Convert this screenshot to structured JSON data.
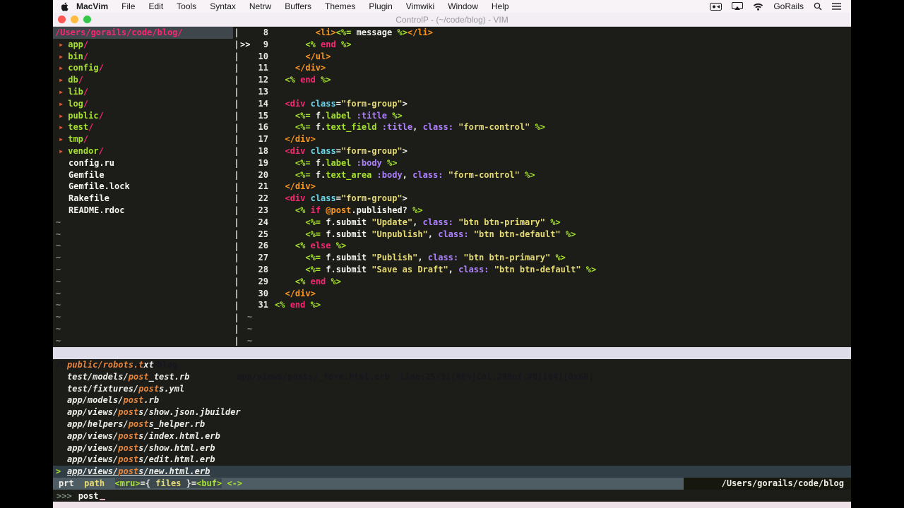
{
  "colors": {
    "w": "#f8f8f2",
    "p": "#f92672",
    "g": "#a6e22e",
    "y": "#e6db74",
    "o": "#fd971f",
    "u": "#ae81ff",
    "c": "#66d9ef"
  },
  "menubar": {
    "items": [
      "MacVim",
      "File",
      "Edit",
      "Tools",
      "Syntax",
      "Netrw",
      "Buffers",
      "Themes",
      "Plugin",
      "Vimwiki",
      "Window",
      "Help"
    ],
    "right_label": "GoRails"
  },
  "titlebar": {
    "title": "ControlP - (~/code/blog) - VIM"
  },
  "nerdtree": {
    "root": "/Users/gorails/code/blog/",
    "dirs": [
      "app",
      "bin",
      "config",
      "db",
      "lib",
      "log",
      "public",
      "test",
      "tmp",
      "vendor"
    ],
    "files": [
      "config.ru",
      "Gemfile",
      "Gemfile.lock",
      "Rakefile",
      "README.rdoc"
    ],
    "tilde": "~",
    "tilde_count": 11
  },
  "editor": {
    "tilde": "~",
    "tilde_count": 3,
    "lines": [
      {
        "n": "8",
        "s": "",
        "t": [
          [
            "        ",
            "w"
          ],
          [
            "<li>",
            "o"
          ],
          [
            "<%=",
            "g"
          ],
          [
            " message ",
            "w"
          ],
          [
            "%>",
            "g"
          ],
          [
            "</li>",
            "o"
          ]
        ]
      },
      {
        "n": "9",
        "s": ">>",
        "t": [
          [
            "      ",
            "w"
          ],
          [
            "<%",
            "g"
          ],
          [
            " ",
            "w"
          ],
          [
            "end",
            "p"
          ],
          [
            " ",
            "w"
          ],
          [
            "%>",
            "g"
          ]
        ]
      },
      {
        "n": "10",
        "s": "",
        "t": [
          [
            "      ",
            "w"
          ],
          [
            "</ul>",
            "o"
          ]
        ]
      },
      {
        "n": "11",
        "s": "",
        "t": [
          [
            "    ",
            "w"
          ],
          [
            "</div>",
            "o"
          ]
        ]
      },
      {
        "n": "12",
        "s": "",
        "t": [
          [
            "  ",
            "w"
          ],
          [
            "<%",
            "g"
          ],
          [
            " ",
            "w"
          ],
          [
            "end",
            "p"
          ],
          [
            " ",
            "w"
          ],
          [
            "%>",
            "g"
          ]
        ]
      },
      {
        "n": "13",
        "s": "",
        "t": []
      },
      {
        "n": "14",
        "s": "",
        "t": [
          [
            "  ",
            "w"
          ],
          [
            "<div",
            "p"
          ],
          [
            " ",
            "w"
          ],
          [
            "class",
            "c"
          ],
          [
            "=",
            "w"
          ],
          [
            "\"form-group\"",
            "y"
          ],
          [
            ">",
            "w"
          ]
        ]
      },
      {
        "n": "15",
        "s": "",
        "t": [
          [
            "    ",
            "w"
          ],
          [
            "<%=",
            "g"
          ],
          [
            " f.",
            "w"
          ],
          [
            "label",
            "g"
          ],
          [
            " ",
            "w"
          ],
          [
            ":title",
            "u"
          ],
          [
            " ",
            "w"
          ],
          [
            "%>",
            "g"
          ]
        ]
      },
      {
        "n": "16",
        "s": "",
        "t": [
          [
            "    ",
            "w"
          ],
          [
            "<%=",
            "g"
          ],
          [
            " f.",
            "w"
          ],
          [
            "text_field",
            "g"
          ],
          [
            " ",
            "w"
          ],
          [
            ":title",
            "u"
          ],
          [
            ", ",
            "w"
          ],
          [
            "class:",
            "u"
          ],
          [
            " ",
            "w"
          ],
          [
            "\"form-control\"",
            "y"
          ],
          [
            " ",
            "w"
          ],
          [
            "%>",
            "g"
          ]
        ]
      },
      {
        "n": "17",
        "s": "",
        "t": [
          [
            "  ",
            "w"
          ],
          [
            "</div>",
            "o"
          ]
        ]
      },
      {
        "n": "18",
        "s": "",
        "t": [
          [
            "  ",
            "w"
          ],
          [
            "<div",
            "p"
          ],
          [
            " ",
            "w"
          ],
          [
            "class",
            "c"
          ],
          [
            "=",
            "w"
          ],
          [
            "\"form-group\"",
            "y"
          ],
          [
            ">",
            "w"
          ]
        ]
      },
      {
        "n": "19",
        "s": "",
        "t": [
          [
            "    ",
            "w"
          ],
          [
            "<%=",
            "g"
          ],
          [
            " f.",
            "w"
          ],
          [
            "label",
            "g"
          ],
          [
            " ",
            "w"
          ],
          [
            ":body",
            "u"
          ],
          [
            " ",
            "w"
          ],
          [
            "%>",
            "g"
          ]
        ]
      },
      {
        "n": "20",
        "s": "",
        "t": [
          [
            "    ",
            "w"
          ],
          [
            "<%=",
            "g"
          ],
          [
            " f.",
            "w"
          ],
          [
            "text_area",
            "g"
          ],
          [
            " ",
            "w"
          ],
          [
            ":body",
            "u"
          ],
          [
            ", ",
            "w"
          ],
          [
            "class:",
            "u"
          ],
          [
            " ",
            "w"
          ],
          [
            "\"form-control\"",
            "y"
          ],
          [
            " ",
            "w"
          ],
          [
            "%>",
            "g"
          ]
        ]
      },
      {
        "n": "21",
        "s": "",
        "t": [
          [
            "  ",
            "w"
          ],
          [
            "</div>",
            "o"
          ]
        ]
      },
      {
        "n": "22",
        "s": "",
        "t": [
          [
            "  ",
            "w"
          ],
          [
            "<div",
            "p"
          ],
          [
            " ",
            "w"
          ],
          [
            "class",
            "c"
          ],
          [
            "=",
            "w"
          ],
          [
            "\"form-group\"",
            "y"
          ],
          [
            ">",
            "w"
          ]
        ]
      },
      {
        "n": "23",
        "s": "",
        "t": [
          [
            "    ",
            "w"
          ],
          [
            "<%",
            "g"
          ],
          [
            " ",
            "w"
          ],
          [
            "if",
            "p"
          ],
          [
            " ",
            "w"
          ],
          [
            "@post",
            "o"
          ],
          [
            ".published?",
            "w"
          ],
          [
            " ",
            "w"
          ],
          [
            "%>",
            "g"
          ]
        ]
      },
      {
        "n": "24",
        "s": "",
        "t": [
          [
            "      ",
            "w"
          ],
          [
            "<%=",
            "g"
          ],
          [
            " f.submit ",
            "w"
          ],
          [
            "\"Update\"",
            "y"
          ],
          [
            ", ",
            "w"
          ],
          [
            "class:",
            "u"
          ],
          [
            " ",
            "w"
          ],
          [
            "\"btn btn-primary\"",
            "y"
          ],
          [
            " ",
            "w"
          ],
          [
            "%>",
            "g"
          ]
        ]
      },
      {
        "n": "25",
        "s": "",
        "t": [
          [
            "      ",
            "w"
          ],
          [
            "<%=",
            "g"
          ],
          [
            " f.submit ",
            "w"
          ],
          [
            "\"Unpublish\"",
            "y"
          ],
          [
            ", ",
            "w"
          ],
          [
            "class:",
            "u"
          ],
          [
            " ",
            "w"
          ],
          [
            "\"btn btn-default\"",
            "y"
          ],
          [
            " ",
            "w"
          ],
          [
            "%>",
            "g"
          ]
        ]
      },
      {
        "n": "26",
        "s": "",
        "t": [
          [
            "    ",
            "w"
          ],
          [
            "<%",
            "g"
          ],
          [
            " ",
            "w"
          ],
          [
            "else",
            "p"
          ],
          [
            " ",
            "w"
          ],
          [
            "%>",
            "g"
          ]
        ]
      },
      {
        "n": "27",
        "s": "",
        "t": [
          [
            "      ",
            "w"
          ],
          [
            "<%=",
            "g"
          ],
          [
            " f.submit ",
            "w"
          ],
          [
            "\"Publish\"",
            "y"
          ],
          [
            ", ",
            "w"
          ],
          [
            "class:",
            "u"
          ],
          [
            " ",
            "w"
          ],
          [
            "\"btn btn-primary\"",
            "y"
          ],
          [
            " ",
            "w"
          ],
          [
            "%>",
            "g"
          ]
        ]
      },
      {
        "n": "28",
        "s": "",
        "t": [
          [
            "      ",
            "w"
          ],
          [
            "<%=",
            "g"
          ],
          [
            " f.submit ",
            "w"
          ],
          [
            "\"Save as Draft\"",
            "y"
          ],
          [
            ", ",
            "w"
          ],
          [
            "class:",
            "u"
          ],
          [
            " ",
            "w"
          ],
          [
            "\"btn btn-default\"",
            "y"
          ],
          [
            " ",
            "w"
          ],
          [
            "%>",
            "g"
          ]
        ]
      },
      {
        "n": "29",
        "s": "",
        "t": [
          [
            "    ",
            "w"
          ],
          [
            "<%",
            "g"
          ],
          [
            " ",
            "w"
          ],
          [
            "end",
            "p"
          ],
          [
            " ",
            "w"
          ],
          [
            "%>",
            "g"
          ]
        ]
      },
      {
        "n": "30",
        "s": "",
        "t": [
          [
            "  ",
            "w"
          ],
          [
            "</div>",
            "o"
          ]
        ]
      },
      {
        "n": "31",
        "s": "",
        "t": [
          [
            "<%",
            "g"
          ],
          [
            " ",
            "w"
          ],
          [
            "end",
            "p"
          ],
          [
            " ",
            "w"
          ],
          [
            "%>",
            "g"
          ]
        ]
      }
    ]
  },
  "statusline": {
    "left": "/Users/gorails/code/blog",
    "right": "app/views/posts/_form.html.erb  Line:25/31[80%]Col:29Buf:#8[104][0x68]"
  },
  "ctrlp": {
    "results": [
      {
        "sel": false,
        "seg": [
          [
            "public/robots.t",
            "m"
          ],
          [
            "xt",
            "n"
          ]
        ]
      },
      {
        "sel": false,
        "seg": [
          [
            "test/models/",
            "n"
          ],
          [
            "post",
            "m"
          ],
          [
            "_test.rb",
            "n"
          ]
        ]
      },
      {
        "sel": false,
        "seg": [
          [
            "test/fixtures/",
            "n"
          ],
          [
            "post",
            "m"
          ],
          [
            "s.yml",
            "n"
          ]
        ]
      },
      {
        "sel": false,
        "seg": [
          [
            "app/models/",
            "n"
          ],
          [
            "post",
            "m"
          ],
          [
            ".rb",
            "n"
          ]
        ]
      },
      {
        "sel": false,
        "seg": [
          [
            "app/views/",
            "n"
          ],
          [
            "post",
            "m"
          ],
          [
            "s/show.json.jbuilder",
            "n"
          ]
        ]
      },
      {
        "sel": false,
        "seg": [
          [
            "app/helpers/",
            "n"
          ],
          [
            "post",
            "m"
          ],
          [
            "s_helper.rb",
            "n"
          ]
        ]
      },
      {
        "sel": false,
        "seg": [
          [
            "app/views/",
            "n"
          ],
          [
            "post",
            "m"
          ],
          [
            "s/index.html.erb",
            "n"
          ]
        ]
      },
      {
        "sel": false,
        "seg": [
          [
            "app/views/",
            "n"
          ],
          [
            "post",
            "m"
          ],
          [
            "s/show.html.erb",
            "n"
          ]
        ]
      },
      {
        "sel": false,
        "seg": [
          [
            "app/views/",
            "n"
          ],
          [
            "post",
            "m"
          ],
          [
            "s/edit.html.erb",
            "n"
          ]
        ]
      },
      {
        "sel": true,
        "marker": ">",
        "seg": [
          [
            "app/views/",
            "n"
          ],
          [
            "post",
            "m"
          ],
          [
            "s/new.html.erb",
            "n"
          ]
        ]
      }
    ],
    "status": {
      "mode": "prt",
      "path_label": "path",
      "mru": "<mru>",
      "eq1": "={",
      "files_label": " files ",
      "eq2": "}=",
      "buf": "<buf>",
      "cycle": " <->"
    },
    "status_right": "/Users/gorails/code/blog",
    "prompt_marker": ">>>",
    "query": "post"
  }
}
